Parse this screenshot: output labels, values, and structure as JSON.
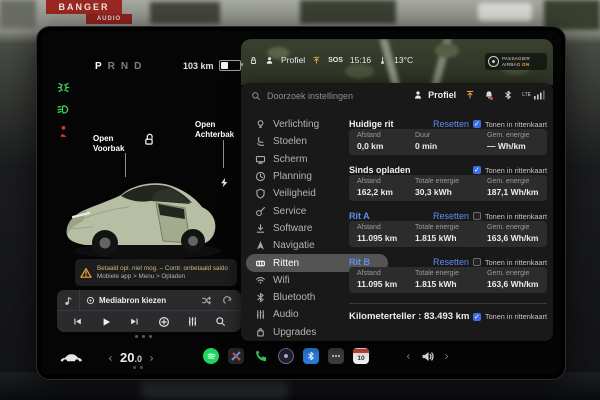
{
  "colors": {
    "accent_blue": "#5f8df0",
    "warning_amber": "#e9a93d",
    "indicator_green": "#3fd35a",
    "indicator_red": "#e03131",
    "spotify_green": "#1ed760",
    "phone_green": "#35c759",
    "checkbox_blue": "#3d6fe0"
  },
  "environment": {
    "sign_top": "BANGER",
    "sign_bottom": "AUDIO"
  },
  "top_status": {
    "profile_label": "Profiel",
    "sos": "SOS",
    "time": "15:16",
    "outside_temp": "13°C",
    "airbag_line1": "PASSAGIER",
    "airbag_line2": "AIRBAG",
    "airbag_state": "ON"
  },
  "vehicle_status": {
    "gears": [
      "P",
      "R",
      "N",
      "D"
    ],
    "range": "103 km"
  },
  "car_panel": {
    "frunk_line1": "Open",
    "frunk_line2": "Voorbak",
    "trunk_line1": "Open",
    "trunk_line2": "Achterbak",
    "alert_line1": "Betaald opl. niet mog. – Contr. onbetaald saldo",
    "alert_line2": "Mobiele app > Menu > Opladen"
  },
  "media": {
    "source_label": "Mediabron kiezen"
  },
  "launcher": {
    "temperature": "20",
    "temperature_decimal": ".0",
    "calendar_day": "10"
  },
  "settings": {
    "search_placeholder": "Doorzoek instellingen",
    "profile_label": "Profiel",
    "network_label": "LTE",
    "menu": [
      {
        "label": "Verlichting"
      },
      {
        "label": "Stoelen"
      },
      {
        "label": "Scherm"
      },
      {
        "label": "Planning"
      },
      {
        "label": "Veiligheid"
      },
      {
        "label": "Service"
      },
      {
        "label": "Software"
      },
      {
        "label": "Navigatie"
      },
      {
        "label": "Ritten",
        "selected": true
      },
      {
        "label": "Wifi"
      },
      {
        "label": "Bluetooth"
      },
      {
        "label": "Audio"
      },
      {
        "label": "Upgrades"
      }
    ],
    "trips": {
      "sections": [
        {
          "title": "Huidige rit",
          "reset_label": "Resetten",
          "show_label": "Tonen in rittenkaart",
          "checked": true,
          "stats": [
            {
              "label": "Afstand",
              "value": "0,0 km"
            },
            {
              "label": "Duur",
              "value": "0 min"
            },
            {
              "label": "Gem. energie",
              "value": "— Wh/km"
            }
          ]
        },
        {
          "title": "Sinds opladen",
          "reset_label": "",
          "show_label": "Tonen in rittenkaart",
          "checked": true,
          "stats": [
            {
              "label": "Afstand",
              "value": "162,2 km"
            },
            {
              "label": "Totale energie",
              "value": "30,3 kWh"
            },
            {
              "label": "Gem. energie",
              "value": "187,1 Wh/km"
            }
          ]
        },
        {
          "title": "Rit A",
          "blue": true,
          "reset_label": "Resetten",
          "show_label": "Tonen in rittenkaart",
          "checked": false,
          "stats": [
            {
              "label": "Afstand",
              "value": "11.095 km"
            },
            {
              "label": "Totale energie",
              "value": "1.815 kWh"
            },
            {
              "label": "Gem. energie",
              "value": "163,6 Wh/km"
            }
          ]
        },
        {
          "title": "Rit B",
          "blue": true,
          "reset_label": "Resetten",
          "show_label": "Tonen in rittenkaart",
          "checked": false,
          "stats": [
            {
              "label": "Afstand",
              "value": "11.095 km"
            },
            {
              "label": "Totale energie",
              "value": "1.815 kWh"
            },
            {
              "label": "Gem. energie",
              "value": "163,6 Wh/km"
            }
          ]
        }
      ],
      "odometer_label": "Kilometerteller : 83.493 km",
      "odometer_show_label": "Tonen in rittenkaart",
      "odometer_checked": true
    }
  }
}
